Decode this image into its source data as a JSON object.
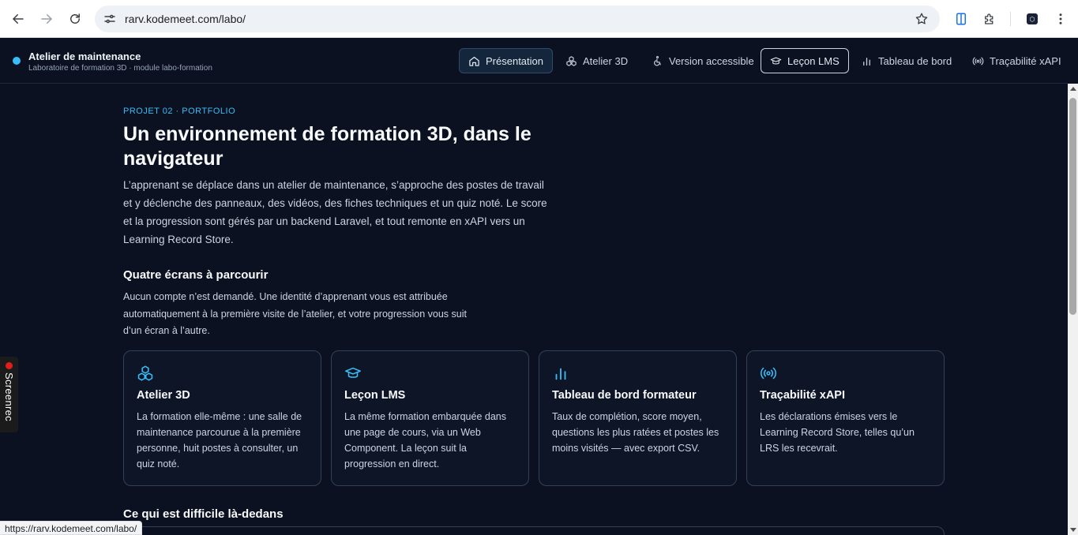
{
  "browser": {
    "url": "rarv.kodemeet.com/labo/",
    "status_url": "https://rarv.kodemeet.com/labo/"
  },
  "header": {
    "title": "Atelier de maintenance",
    "subtitle": "Laboratoire de formation 3D · module labo-formation",
    "nav": [
      {
        "label": "Présentation",
        "icon": "home-icon",
        "state": "active"
      },
      {
        "label": "Atelier 3D",
        "icon": "cubes-icon"
      },
      {
        "label": "Version accessible",
        "icon": "accessibility-icon"
      },
      {
        "label": "Leçon LMS",
        "icon": "graduation-cap-icon",
        "state": "outlined"
      },
      {
        "label": "Tableau de bord",
        "icon": "bar-chart-icon"
      },
      {
        "label": "Traçabilité xAPI",
        "icon": "broadcast-icon"
      }
    ]
  },
  "main": {
    "eyebrow": "PROJET 02 · PORTFOLIO",
    "title": "Un environnement de formation 3D, dans le navigateur",
    "lead": "L’apprenant se déplace dans un atelier de maintenance, s’approche des postes de travail et y déclenche des panneaux, des vidéos, des fiches techniques et un quiz noté. Le score et la progression sont gérés par un backend Laravel, et tout remonte en xAPI vers un Learning Record Store.",
    "section_title": "Quatre écrans à parcourir",
    "section_intro": "Aucun compte n’est demandé. Une identité d’apprenant vous est attribuée automatiquement à la première visite de l’atelier, et votre progression vous suit d’un écran à l’autre.",
    "cards": [
      {
        "icon": "cubes-icon",
        "title": "Atelier 3D",
        "desc": "La formation elle-même : une salle de maintenance parcourue à la première personne, huit postes à consulter, un quiz noté."
      },
      {
        "icon": "graduation-cap-icon",
        "title": "Leçon LMS",
        "desc": "La même formation embarquée dans une page de cours, via un Web Component. La leçon suit la progression en direct."
      },
      {
        "icon": "bar-chart-icon",
        "title": "Tableau de bord formateur",
        "desc": "Taux de complétion, score moyen, questions les plus ratées et postes les moins visités — avec export CSV."
      },
      {
        "icon": "broadcast-icon",
        "title": "Traçabilité xAPI",
        "desc": "Les déclarations émises vers le Learning Record Store, telles qu’un LRS les recevrait."
      }
    ],
    "next_title": "Ce qui est difficile là-dedans"
  },
  "overlay": {
    "screenrec_label": "Screenrec"
  },
  "colors": {
    "background": "#0b1120",
    "accent": "#38bdf8",
    "card_border": "#334155"
  }
}
